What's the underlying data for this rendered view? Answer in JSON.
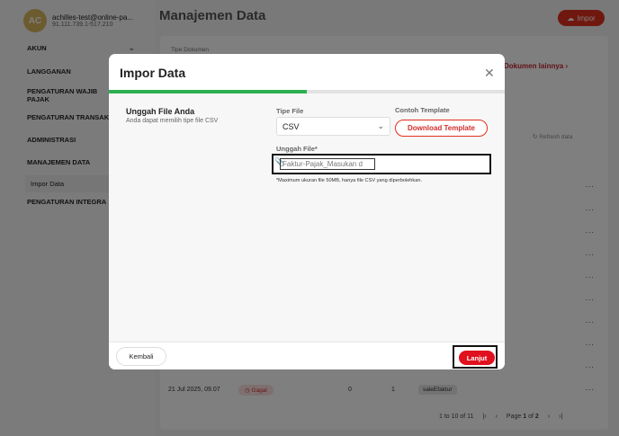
{
  "app": {
    "user_initials": "AC",
    "user_email": "achilles-test@online-pa...",
    "user_npwp": "91.111.739.1-517.210",
    "page_title": "Manajemen Data",
    "impor_label": "Impor"
  },
  "sidebar": {
    "items": [
      {
        "label": "AKUN"
      },
      {
        "label": "LANGGANAN"
      },
      {
        "label": "PENGATURAN WAJIB PAJAK"
      },
      {
        "label": "PENGATURAN TRANSAK"
      },
      {
        "label": "ADMINISTRASI"
      },
      {
        "label": "MANAJEMEN DATA"
      },
      {
        "label": "Impor Data"
      },
      {
        "label": "PENGATURAN INTEGRA"
      }
    ]
  },
  "background": {
    "tipe_dokumen_label": "Tipe Dokumen",
    "dokumen_link": "Dokumen lainnya",
    "refresh_label": "Refresh data",
    "row": {
      "date": "21 Jul 2025, 09.07",
      "status": "Gagal",
      "n1": "0",
      "n2": "1",
      "tag": "saleEfaktur"
    },
    "pagination": {
      "range": "1 to 10 of 11",
      "page_prefix": "Page",
      "page_current": "1",
      "page_of": "of",
      "page_total": "2"
    }
  },
  "modal": {
    "title": "Impor Data",
    "progress": 0.5,
    "section_title": "Unggah File Anda",
    "section_sub": "Anda dapat memilih tipe file CSV",
    "tipe_file_label": "Tipe File",
    "tipe_file_value": "CSV",
    "contoh_label": "Contoh Template",
    "download_label": "Download Template",
    "unggah_label": "Unggah File*",
    "upload_placeholder": "Faktur-Pajak_Masukan d",
    "upload_note": "*Maximum ukuran file 50MB, hanya file CSV yang diperbolehkan.",
    "back_label": "Kembali",
    "next_label": "Lanjut"
  }
}
